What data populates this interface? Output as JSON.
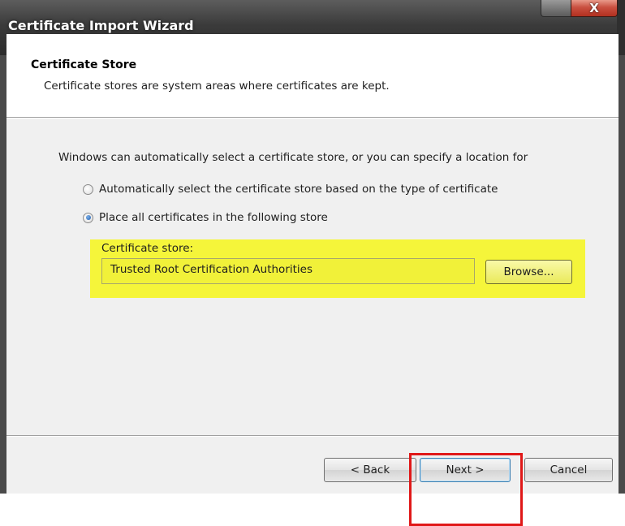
{
  "window": {
    "title": "Certificate Import Wizard",
    "close_glyph": "X"
  },
  "header": {
    "title": "Certificate Store",
    "description": "Certificate stores are system areas where certificates are kept."
  },
  "main": {
    "intro": "Windows can automatically select a certificate store, or you can specify a location for",
    "options": [
      {
        "label": "Automatically select the certificate store based on the type of certificate",
        "selected": false
      },
      {
        "label": "Place all certificates in the following store",
        "selected": true
      }
    ],
    "store_label": "Certificate store:",
    "store_value": "Trusted Root Certification Authorities",
    "browse_label": "Browse..."
  },
  "footer": {
    "back_label": "< Back",
    "next_label": "Next >",
    "cancel_label": "Cancel"
  },
  "annotations": {
    "store_highlight_color": "#f5f53a",
    "next_highlight_color": "#e01818"
  }
}
